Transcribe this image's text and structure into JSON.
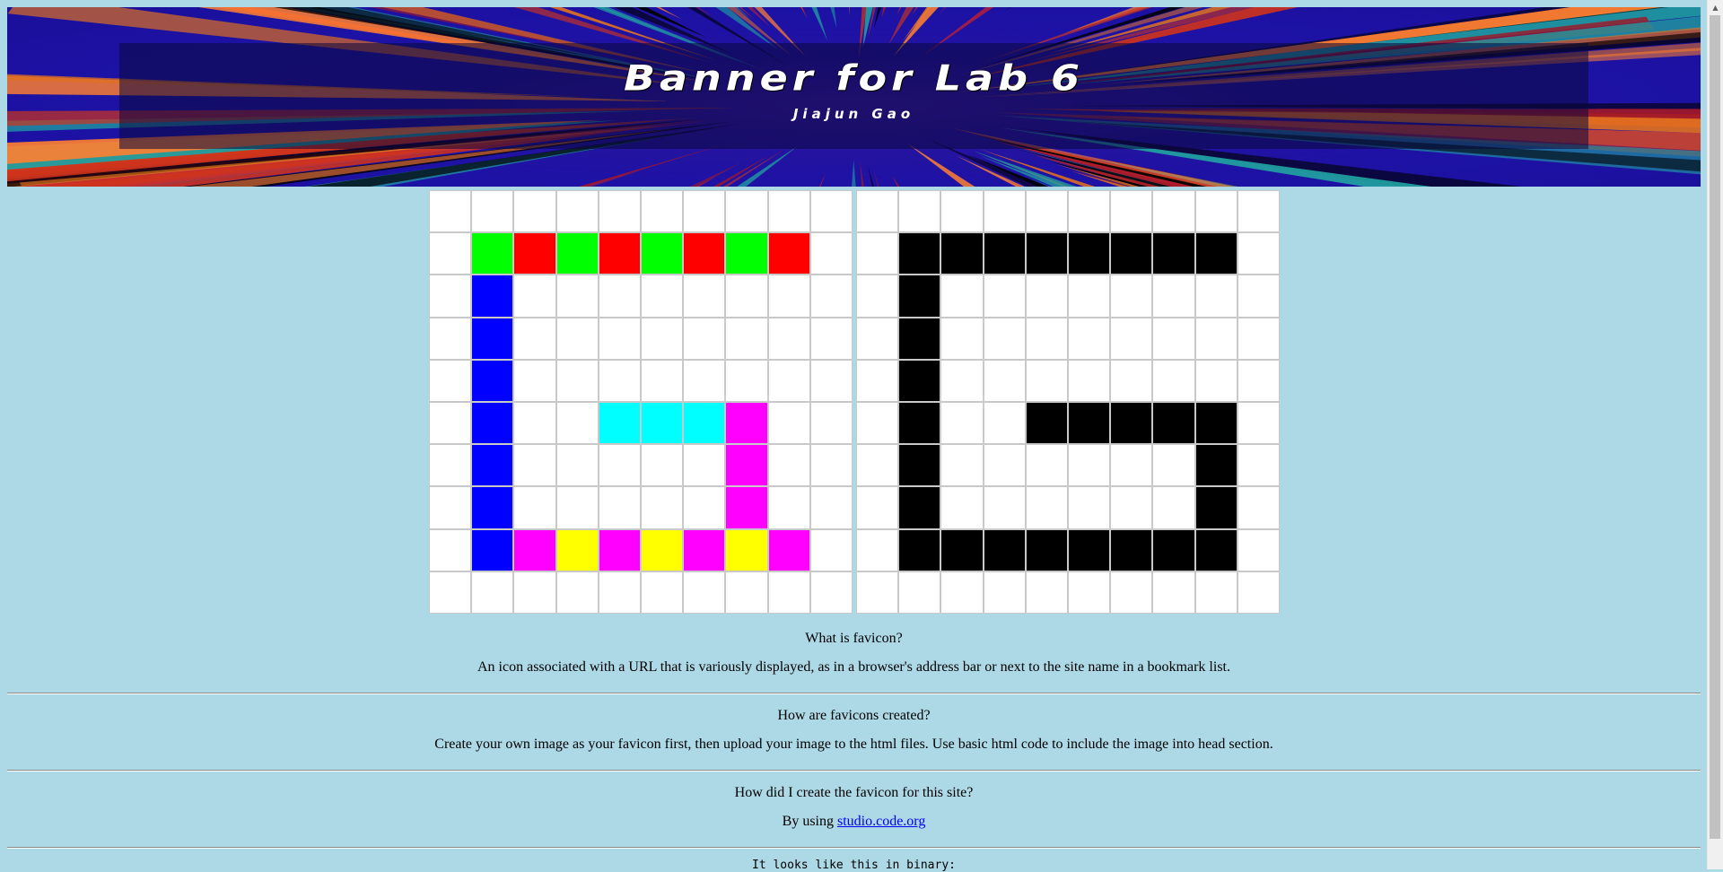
{
  "banner": {
    "title": "Banner for Lab 6",
    "subtitle": "Jiajun Gao"
  },
  "colors": {
    "background": "#add8e6",
    "green": "#00ff00",
    "red": "#ff0000",
    "blue": "#0000ff",
    "cyan": "#00ffff",
    "magenta": "#ff00ff",
    "yellow": "#ffff00",
    "black": "#000000",
    "white": "#ffffff"
  },
  "pixel_art": {
    "color_grid": [
      [
        "W",
        "W",
        "W",
        "W",
        "W",
        "W",
        "W",
        "W",
        "W",
        "W"
      ],
      [
        "W",
        "G",
        "R",
        "G",
        "R",
        "G",
        "R",
        "G",
        "R",
        "W"
      ],
      [
        "W",
        "B",
        "W",
        "W",
        "W",
        "W",
        "W",
        "W",
        "W",
        "W"
      ],
      [
        "W",
        "B",
        "W",
        "W",
        "W",
        "W",
        "W",
        "W",
        "W",
        "W"
      ],
      [
        "W",
        "B",
        "W",
        "W",
        "W",
        "W",
        "W",
        "W",
        "W",
        "W"
      ],
      [
        "W",
        "B",
        "W",
        "W",
        "C",
        "C",
        "C",
        "M",
        "W",
        "W"
      ],
      [
        "W",
        "B",
        "W",
        "W",
        "W",
        "W",
        "W",
        "M",
        "W",
        "W"
      ],
      [
        "W",
        "B",
        "W",
        "W",
        "W",
        "W",
        "W",
        "M",
        "W",
        "W"
      ],
      [
        "W",
        "B",
        "M",
        "Y",
        "M",
        "Y",
        "M",
        "Y",
        "M",
        "W"
      ],
      [
        "W",
        "W",
        "W",
        "W",
        "W",
        "W",
        "W",
        "W",
        "W",
        "W"
      ]
    ],
    "mono_grid": [
      [
        0,
        0,
        0,
        0,
        0,
        0,
        0,
        0,
        0,
        0
      ],
      [
        0,
        1,
        1,
        1,
        1,
        1,
        1,
        1,
        1,
        0
      ],
      [
        0,
        1,
        0,
        0,
        0,
        0,
        0,
        0,
        0,
        0
      ],
      [
        0,
        1,
        0,
        0,
        0,
        0,
        0,
        0,
        0,
        0
      ],
      [
        0,
        1,
        0,
        0,
        0,
        0,
        0,
        0,
        0,
        0
      ],
      [
        0,
        1,
        0,
        0,
        1,
        1,
        1,
        1,
        1,
        0
      ],
      [
        0,
        1,
        0,
        0,
        0,
        0,
        0,
        0,
        1,
        0
      ],
      [
        0,
        1,
        0,
        0,
        0,
        0,
        0,
        0,
        1,
        0
      ],
      [
        0,
        1,
        1,
        1,
        1,
        1,
        1,
        1,
        1,
        0
      ],
      [
        0,
        0,
        0,
        0,
        0,
        0,
        0,
        0,
        0,
        0
      ]
    ]
  },
  "sections": {
    "q1": "What is favicon?",
    "a1": "An icon associated with a URL that is variously displayed, as in a browser's address bar or next to the site name in a bookmark list.",
    "q2": "How are favicons created?",
    "a2": "Create your own image as your favicon first, then upload your image to the html files. Use basic html code to include the image into head section.",
    "q3": "How did I create the favicon for this site?",
    "a3_prefix": "By using ",
    "a3_link": "studio.code.org",
    "binary_label": "It looks like this in binary:"
  }
}
